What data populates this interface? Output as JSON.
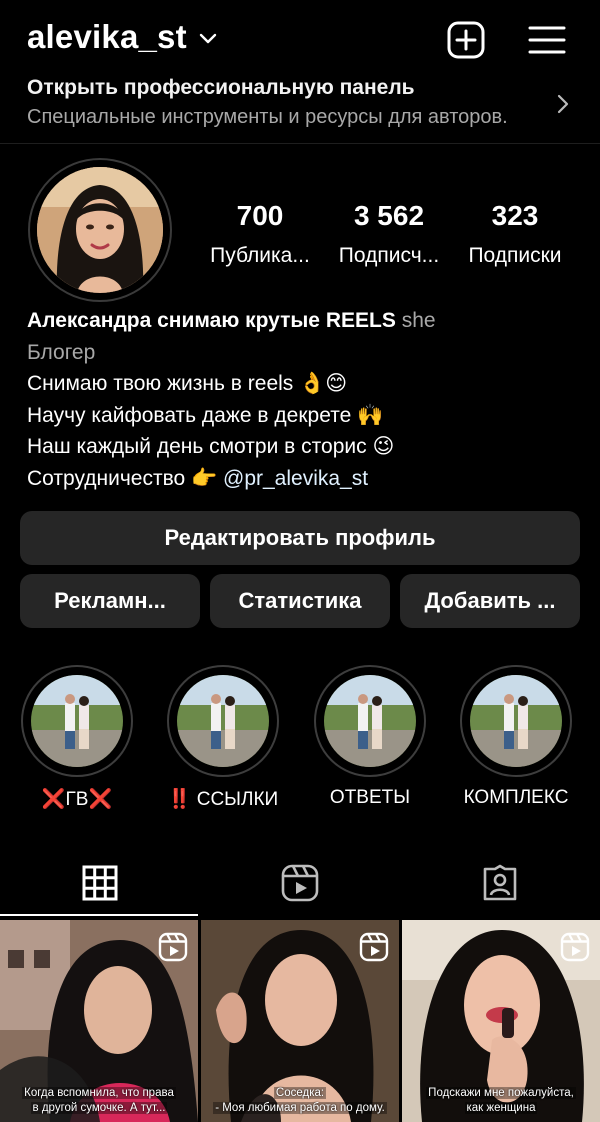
{
  "header": {
    "username": "alevika_st"
  },
  "pro_panel": {
    "title": "Открыть профессиональную панель",
    "subtitle": "Специальные инструменты и ресурсы для авторов."
  },
  "stats": [
    {
      "value": "700",
      "label": "Публика..."
    },
    {
      "value": "3 562",
      "label": "Подписч..."
    },
    {
      "value": "323",
      "label": "Подписки"
    }
  ],
  "bio": {
    "name": "Александра снимаю крутые REELS",
    "pronouns": "she",
    "category": "Блогер",
    "line1": "Снимаю твою жизнь в reels",
    "line1_emoji": "👌😊",
    "line2": "Научу кайфовать даже в декрете",
    "line2_emoji": "🙌",
    "line3": "Наш каждый день смотри в сторис",
    "line3_emoji": "😉",
    "line4": "Сотрудничество",
    "line4_emoji": "👉",
    "mention": "@pr_alevika_st"
  },
  "buttons": {
    "edit": "Редактировать профиль",
    "ads": "Рекламн...",
    "statistics": "Статистика",
    "add": "Добавить ..."
  },
  "highlights": [
    {
      "label": "❌ГВ❌"
    },
    {
      "label": "‼️ ССЫЛКИ"
    },
    {
      "label": "ОТВЕТЫ"
    },
    {
      "label": "КОМПЛЕКС"
    }
  ],
  "posts": [
    {
      "caption_1": "Когда вспомнила, что права",
      "caption_2": "в другой сумочке. А тут..."
    },
    {
      "caption_1": "Соседка:",
      "caption_2": "- Моя любимая работа по дому."
    },
    {
      "caption_1": "Подскажи мне пожалуйста,",
      "caption_2": "как женщина"
    }
  ],
  "colors": {
    "background": "#000000",
    "button": "#262626",
    "secondary_text": "#a8a8a8"
  }
}
